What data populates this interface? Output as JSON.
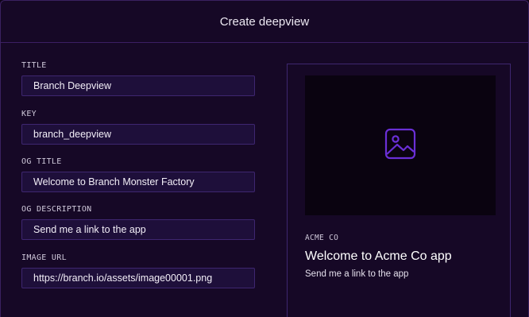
{
  "header": {
    "title": "Create deepview"
  },
  "form": {
    "fields": [
      {
        "label": "TITLE",
        "value": "Branch Deepview"
      },
      {
        "label": "KEY",
        "value": "branch_deepview"
      },
      {
        "label": "OG TITLE",
        "value": "Welcome to Branch Monster Factory"
      },
      {
        "label": "OG DESCRIPTION",
        "value": "Send me a link to the app"
      },
      {
        "label": "IMAGE URL",
        "value": "https://branch.io/assets/image00001.png"
      }
    ]
  },
  "preview": {
    "image_icon": "image-placeholder-icon",
    "site_name": "ACME CO",
    "title": "Welcome to Acme Co app",
    "description": "Send me a link to the app"
  },
  "colors": {
    "background": "#160826",
    "input_background": "#1e0f3a",
    "border": "#3e2670",
    "icon": "#6a2fd6"
  }
}
